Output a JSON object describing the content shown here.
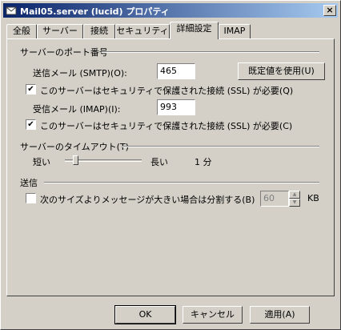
{
  "window": {
    "title": "Mail05.server (lucid) プロパティ",
    "close_label": "×"
  },
  "tabs": [
    "全般",
    "サーバー",
    "接続",
    "セキュリティ",
    "詳細設定",
    "IMAP"
  ],
  "ports": {
    "section_label": "サーバーのポート番号",
    "smtp_label": "送信メール (SMTP)(O):",
    "smtp_value": "465",
    "default_button": "既定値を使用(U)",
    "smtp_ssl_checked": true,
    "smtp_ssl_label": "このサーバーはセキュリティで保護された接続 (SSL) が必要(Q)",
    "imap_label": "受信メール (IMAP)(I):",
    "imap_value": "993",
    "imap_ssl_checked": true,
    "imap_ssl_label": "このサーバーはセキュリティで保護された接続 (SSL) が必要(C)"
  },
  "timeout": {
    "section_label": "サーバーのタイムアウト(T)",
    "short_label": "短い",
    "long_label": "長い",
    "value_text": "1 分",
    "level": 0.1
  },
  "sending": {
    "section_label": "送信",
    "split_checked": false,
    "split_label": "次のサイズよりメッセージが大きい場合は分割する(B)",
    "split_value": "60",
    "unit": "KB"
  },
  "footer": {
    "ok": "OK",
    "cancel": "キャンセル",
    "apply": "適用(A)"
  }
}
